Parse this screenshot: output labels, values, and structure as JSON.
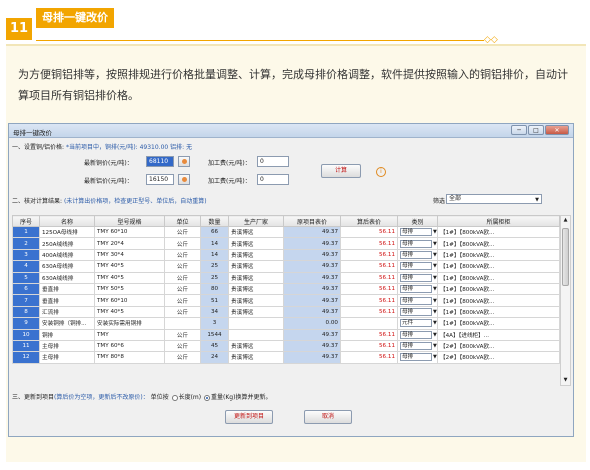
{
  "section": {
    "number": "11",
    "title": "母排一键改价"
  },
  "intro": "为方便铜铝排等，按照排规进行价格批量调整、计算，完成母排价格调整，软件提供按照输入的铜铝排价，自动计算项目所有铜铝排价格。",
  "window": {
    "title": "母排一键改价",
    "buttons": {
      "minimize": "─",
      "maximize": "□",
      "close": "✕"
    },
    "step1": {
      "label": "一、设置铜/铝价格:",
      "current_note": "*当前项目中，铜排(元/吨): 49310.00 铝排: 无",
      "copper_label": "最新铜价(元/吨)：",
      "copper_value": "68110",
      "aluminum_label": "最新铝价(元/吨)：",
      "aluminum_value": "16150",
      "fee1_label": "加工费(元/吨)：",
      "fee1_value": "0",
      "fee2_label": "加工费(元/吨)：",
      "fee2_value": "0",
      "calc_button": "计算",
      "info_icon": "i"
    },
    "step2": {
      "label": "二、核对计算结果:",
      "note": "(未计算出价格项，检查更正型号、单位后，自动重算)",
      "filter_label": "筛选",
      "filter_value": "全部"
    },
    "table": {
      "headers": [
        "序号",
        "名称",
        "型号规格",
        "单位",
        "数量",
        "生产厂家",
        "原项目表价",
        "算后表价",
        "类别",
        "所属柜柜"
      ],
      "rows": [
        {
          "no": "1",
          "name": "125OA母线排",
          "spec": "TMY 60*10",
          "unit": "公斤",
          "qty": "66",
          "maker": "贵溪博远",
          "orig": "49.37",
          "calc": "56.11",
          "cat": "母排",
          "cab": "【1#】【800kVA欧..."
        },
        {
          "no": "2",
          "name": "250A绒线排",
          "spec": "TMY 20*4",
          "unit": "公斤",
          "qty": "14",
          "maker": "贵溪博远",
          "orig": "49.37",
          "calc": "56.11",
          "cat": "母排",
          "cab": "【1#】【800kVA欧..."
        },
        {
          "no": "3",
          "name": "400A绒线排",
          "spec": "TMY 30*4",
          "unit": "公斤",
          "qty": "14",
          "maker": "贵溪博远",
          "orig": "49.37",
          "calc": "56.11",
          "cat": "母排",
          "cab": "【1#】【800kVA欧..."
        },
        {
          "no": "4",
          "name": "630A母线排",
          "spec": "TMY 40*5",
          "unit": "公斤",
          "qty": "25",
          "maker": "贵溪博远",
          "orig": "49.37",
          "calc": "56.11",
          "cat": "母排",
          "cab": "【1#】【800kVA欧..."
        },
        {
          "no": "5",
          "name": "630A绒线排",
          "spec": "TMY 40*5",
          "unit": "公斤",
          "qty": "25",
          "maker": "贵溪博远",
          "orig": "49.37",
          "calc": "56.11",
          "cat": "母排",
          "cab": "【1#】【800kVA欧..."
        },
        {
          "no": "6",
          "name": "垂直排",
          "spec": "TMY 50*5",
          "unit": "公斤",
          "qty": "80",
          "maker": "贵溪博远",
          "orig": "49.37",
          "calc": "56.11",
          "cat": "母排",
          "cab": "【1#】【800kVA欧..."
        },
        {
          "no": "7",
          "name": "垂直排",
          "spec": "TMY 60*10",
          "unit": "公斤",
          "qty": "51",
          "maker": "贵溪博远",
          "orig": "49.37",
          "calc": "56.11",
          "cat": "母排",
          "cab": "【1#】【800kVA欧..."
        },
        {
          "no": "8",
          "name": "汇流排",
          "spec": "TMY 40*5",
          "unit": "公斤",
          "qty": "34",
          "maker": "贵溪博远",
          "orig": "49.37",
          "calc": "56.11",
          "cat": "母排",
          "cab": "【1#】【800kVA欧..."
        },
        {
          "no": "9",
          "name": "安装铜排（铜排...",
          "spec": "安装实际需用铜排",
          "unit": "",
          "qty": "3",
          "maker": "",
          "orig": "0.00",
          "calc": "",
          "cat": "元件",
          "cab": "【1#】【800kVA欧..."
        },
        {
          "no": "10",
          "name": "铜排",
          "spec": "TMY",
          "unit": "公斤",
          "qty": "1544",
          "maker": "",
          "orig": "49.37",
          "calc": "56.11",
          "cat": "母排",
          "cab": "【4A】【进线柜】..."
        },
        {
          "no": "11",
          "name": "主母排",
          "spec": "TMY 60*6",
          "unit": "公斤",
          "qty": "45",
          "maker": "贵溪博远",
          "orig": "49.37",
          "calc": "56.11",
          "cat": "母排",
          "cab": "【2#】【800kVA欧..."
        },
        {
          "no": "12",
          "name": "主母排",
          "spec": "TMY 80*8",
          "unit": "公斤",
          "qty": "24",
          "maker": "贵溪博远",
          "orig": "49.37",
          "calc": "56.11",
          "cat": "母排",
          "cab": "【2#】【800kVA欧..."
        }
      ]
    },
    "step3": {
      "label": "三、更新到项目",
      "note": "(算后价为空项，更新后不改原价)：",
      "unit_label": "单位按",
      "opt_length": "长度(m)",
      "opt_weight": "重量(Kg)",
      "suffix": "换算并更新。"
    },
    "update_button": "更新到项目",
    "cancel_button": "取消"
  }
}
